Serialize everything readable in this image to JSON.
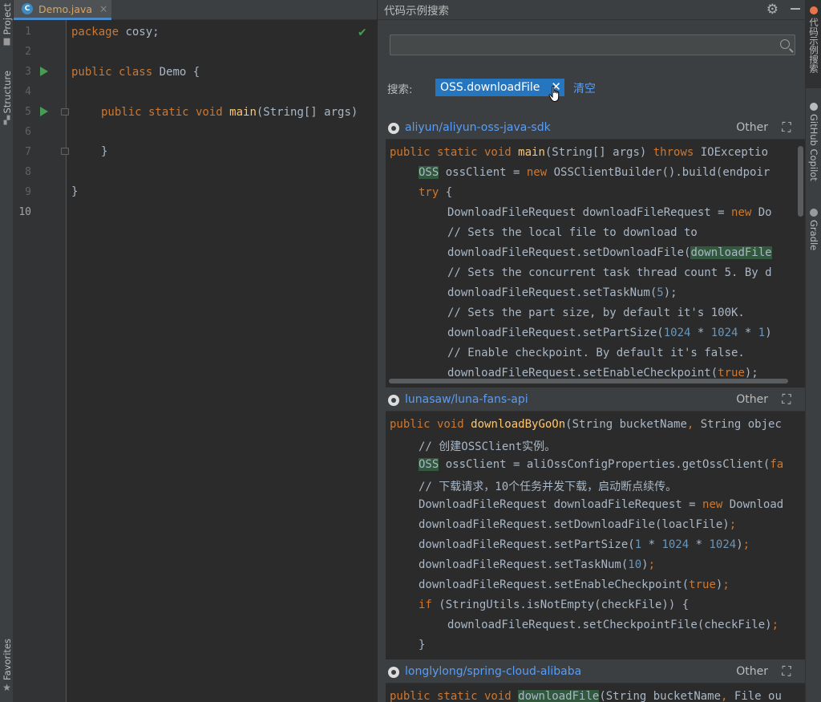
{
  "left_strip": {
    "tabs": [
      {
        "label": "Project",
        "icon": "folder-icon"
      },
      {
        "label": "Structure",
        "icon": "structure-icon"
      },
      {
        "label": "Favorites",
        "icon": "star-icon"
      }
    ]
  },
  "editor": {
    "tab": {
      "label": "Demo.java",
      "close": "×",
      "icon_letter": "C"
    },
    "lines": [
      {
        "n": "1"
      },
      {
        "n": "2"
      },
      {
        "n": "3"
      },
      {
        "n": "4"
      },
      {
        "n": "5"
      },
      {
        "n": "6"
      },
      {
        "n": "7"
      },
      {
        "n": "8"
      },
      {
        "n": "9"
      },
      {
        "n": "10"
      }
    ],
    "code": {
      "l1_kw": "package",
      "l1_rest": " cosy;",
      "l3_kw": "public class",
      "l3_rest": " Demo {",
      "l5_kw": "public static void",
      "l5_fn": "main",
      "l5_rest": "(String[] args)",
      "l7": "}",
      "l9": "}"
    },
    "status_icon": "check-icon"
  },
  "panel": {
    "title": "代码示例搜索",
    "search": {
      "value": "",
      "placeholder": ""
    },
    "search_label": "搜索:",
    "query_chip": {
      "text": "OSS.downloadFile",
      "close": "✕"
    },
    "clear_label": "清空",
    "results": [
      {
        "repo": "aliyun/aliyun-oss-java-sdk",
        "other": "Other",
        "code": {
          "a_kw1": "public static void",
          "a_fn": "main",
          "a_mid": "(String[] args) ",
          "a_kw2": "throws",
          "a_rest": " IOExceptio",
          "b_hl": "OSS",
          "b_mid": " ossClient = ",
          "b_kw": "new",
          "b_rest": " OSSClientBuilder().build(endpoir",
          "c_kw": "try",
          "c_rest": " {",
          "d_mid": "DownloadFileRequest downloadFileRequest = ",
          "d_kw": "new",
          "d_rest": " Do",
          "e": "// Sets the local file to download to",
          "f_pre": "downloadFileRequest.setDownloadFile(",
          "f_hl": "downloadFile",
          "g": "// Sets the concurrent task thread count 5. By d",
          "h_pre": "downloadFileRequest.setTaskNum(",
          "h_num": "5",
          "h_post": ");",
          "i": "// Sets the part size, by default it's 100K.",
          "j_pre": "downloadFileRequest.setPartSize(",
          "j_n1": "1024",
          "j_op1": " * ",
          "j_n2": "1024",
          "j_op2": " * ",
          "j_n3": "1",
          "j_post": ")",
          "k": "// Enable checkpoint. By default it's false.",
          "l_pre": "downloadFileRequest.setEnableCheckpoint(",
          "l_kw": "true",
          "l_post": ");"
        }
      },
      {
        "repo": "lunasaw/luna-fans-api",
        "other": "Other",
        "code": {
          "a_kw": "public void",
          "a_fn": "downloadByGoOn",
          "a_mid": "(String bucketName",
          "a_comma": ",",
          "a_rest": " String objec",
          "b": "// 创建OSSClient实例。",
          "c_hl": "OSS",
          "c_mid": " ossClient = aliOssConfigProperties.getOssClient(",
          "c_rest": "fa",
          "d": "// 下载请求，10个任务并发下载，启动断点续传。",
          "e_mid": "DownloadFileRequest downloadFileRequest = ",
          "e_kw": "new",
          "e_rest": " Download",
          "f_pre": "downloadFileRequest.setDownloadFile(loaclFile)",
          "f_semi": ";",
          "g_pre": "downloadFileRequest.setPartSize(",
          "g_n1": "1",
          "g_op1": " * ",
          "g_n2": "1024",
          "g_op2": " * ",
          "g_n3": "1024",
          "g_post": ")",
          "g_semi": ";",
          "h_pre": "downloadFileRequest.setTaskNum(",
          "h_num": "10",
          "h_post": ")",
          "h_semi": ";",
          "i_pre": "downloadFileRequest.setEnableCheckpoint(",
          "i_kw": "true",
          "i_post": ")",
          "i_semi": ";",
          "j_kw": "if",
          "j_rest": " (StringUtils.isNotEmpty(checkFile)) {",
          "k_pre": "downloadFileRequest.setCheckpointFile(checkFile)",
          "k_semi": ";",
          "l": "}"
        }
      },
      {
        "repo": "longlylong/spring-cloud-alibaba",
        "other": "Other",
        "code": {
          "a_kw": "public static void",
          "a_hl": "downloadFile",
          "a_rest": "(String bucketName",
          "a_comma": ",",
          "a_tail": " File ou"
        }
      }
    ]
  },
  "right_strip": {
    "tabs": [
      {
        "label": "代码示例搜索",
        "color": "#e8754a"
      },
      {
        "label": "GitHub Copilot",
        "color": "#bbbbbb"
      },
      {
        "label": "Gradle",
        "color": "#9a9a9a"
      }
    ]
  },
  "colors": {
    "keyword": "#cc7832",
    "function": "#ffc66d",
    "number": "#6897bb",
    "comment": "#808080",
    "link": "#589df6",
    "chip": "#2675bf",
    "run": "#499c54"
  }
}
